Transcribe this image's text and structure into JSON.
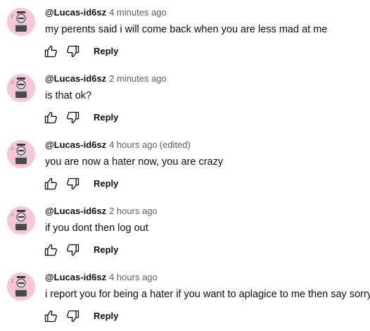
{
  "actions": {
    "reply_label": "Reply"
  },
  "comments": [
    {
      "author": "@Lucas-id6sz",
      "time": "4 minutes ago",
      "edited": "",
      "text": "my perents said i will come back when you are less mad at me"
    },
    {
      "author": "@Lucas-id6sz",
      "time": "2 minutes ago",
      "edited": "",
      "text": "is that ok?"
    },
    {
      "author": "@Lucas-id6sz",
      "time": "4 hours ago",
      "edited": "(edited)",
      "text": "you are now a hater now, you are crazy"
    },
    {
      "author": "@Lucas-id6sz",
      "time": "2 hours ago",
      "edited": "",
      "text": "if you dont then log out"
    },
    {
      "author": "@Lucas-id6sz",
      "time": "4 hours ago",
      "edited": "",
      "text": "i report you for being a hater if you want to aplagice to me then say sorry"
    }
  ],
  "icons": {
    "like": "thumbs-up-icon",
    "dislike": "thumbs-down-icon"
  },
  "colors": {
    "avatar_bg": "#f7c6d8",
    "meta": "#606060",
    "text": "#0f0f0f"
  }
}
